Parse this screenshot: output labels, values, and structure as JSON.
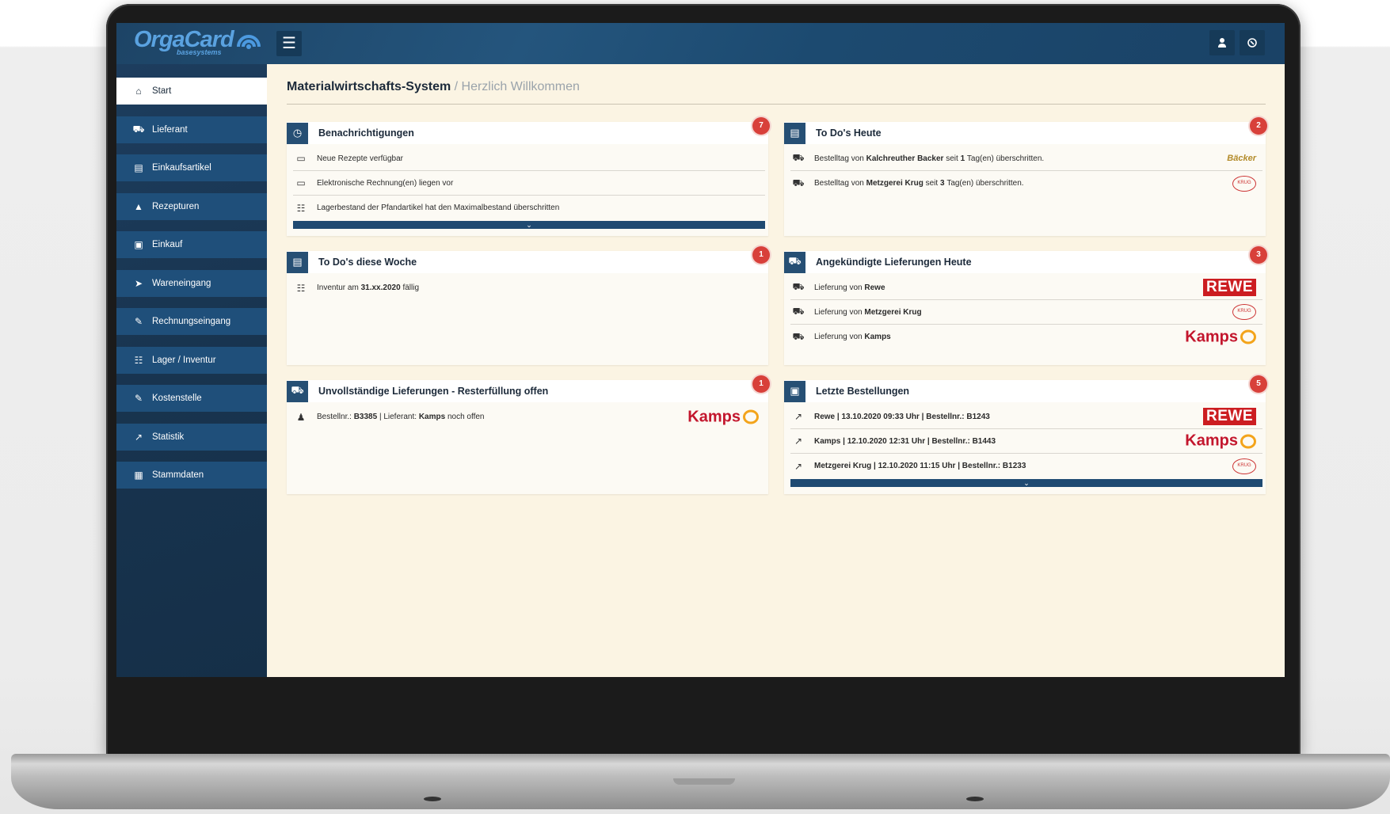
{
  "app": {
    "logo_text": "OrgaCard",
    "logo_sub": "basesystems"
  },
  "header": {
    "menu_icon": "hamburger-icon",
    "user_icon": "user-icon",
    "power_icon": "power-icon"
  },
  "sidebar": {
    "items": [
      {
        "label": "Start",
        "icon": "home-icon"
      },
      {
        "label": "Lieferant",
        "icon": "truck-icon"
      },
      {
        "label": "Einkaufsartikel",
        "icon": "article-icon"
      },
      {
        "label": "Rezepturen",
        "icon": "chef-hat-icon"
      },
      {
        "label": "Einkauf",
        "icon": "cart-icon"
      },
      {
        "label": "Wareneingang",
        "icon": "goods-in-icon"
      },
      {
        "label": "Rechnungseingang",
        "icon": "invoice-icon"
      },
      {
        "label": "Lager / Inventur",
        "icon": "calendar-icon"
      },
      {
        "label": "Kostenstelle",
        "icon": "cost-icon"
      },
      {
        "label": "Statistik",
        "icon": "chart-icon"
      },
      {
        "label": "Stammdaten",
        "icon": "table-icon"
      }
    ]
  },
  "page": {
    "title": "Materialwirtschafts-System",
    "subtitle": " / Herzlich Willkommen"
  },
  "cards": {
    "notifications": {
      "title": "Benachrichtigungen",
      "badge": "7",
      "rows": [
        "Neue Rezepte verfügbar",
        "Elektronische Rechnung(en) liegen vor",
        "Lagerbestand der Pfandartikel hat den Maximalbestand überschritten"
      ]
    },
    "todos_today": {
      "title": "To Do's Heute",
      "badge": "2",
      "rows": [
        {
          "pre": "Bestelltag von ",
          "bold": "Kalchreuther Backer",
          "mid": " seit ",
          "num": "1",
          "post": " Tag(en) überschritten.",
          "logo": "Bäcker"
        },
        {
          "pre": "Bestelltag von ",
          "bold": "Metzgerei Krug",
          "mid": " seit ",
          "num": "3",
          "post": " Tag(en) überschritten.",
          "logo": "KRUG"
        }
      ]
    },
    "todos_week": {
      "title": "To Do's diese Woche",
      "badge": "1",
      "rows": [
        {
          "pre": "Inventur am ",
          "bold": "31.xx.2020",
          "post": " fällig"
        }
      ]
    },
    "deliveries_today": {
      "title": "Angekündigte Lieferungen Heute",
      "badge": "3",
      "rows": [
        {
          "pre": "Lieferung von ",
          "bold": "Rewe",
          "logo": "REWE"
        },
        {
          "pre": "Lieferung von ",
          "bold": "Metzgerei Krug",
          "logo": "KRUG"
        },
        {
          "pre": "Lieferung von ",
          "bold": "Kamps",
          "logo": "Kamps"
        }
      ]
    },
    "incomplete": {
      "title": "Unvollständige Lieferungen - Resterfüllung offen",
      "badge": "1",
      "rows": [
        {
          "pre": "Bestellnr.: ",
          "bold": "B3385",
          "mid": " | Lieferant: ",
          "bold2": "Kamps",
          "post": " noch offen",
          "logo": "Kamps"
        }
      ]
    },
    "last_orders": {
      "title": "Letzte Bestellungen",
      "badge": "5",
      "rows": [
        {
          "text": "Rewe | 13.10.2020 09:33 Uhr | Bestellnr.: B1243",
          "logo": "REWE"
        },
        {
          "text": "Kamps | 12.10.2020 12:31 Uhr | Bestellnr.: B1443",
          "logo": "Kamps"
        },
        {
          "text": "Metzgerei Krug | 12.10.2020 11:15 Uhr | Bestellnr.: B1233",
          "logo": "KRUG"
        }
      ]
    }
  },
  "colors": {
    "accent": "#1f4f7a",
    "badge": "#d8403a",
    "content_bg": "#fbf4e3"
  }
}
